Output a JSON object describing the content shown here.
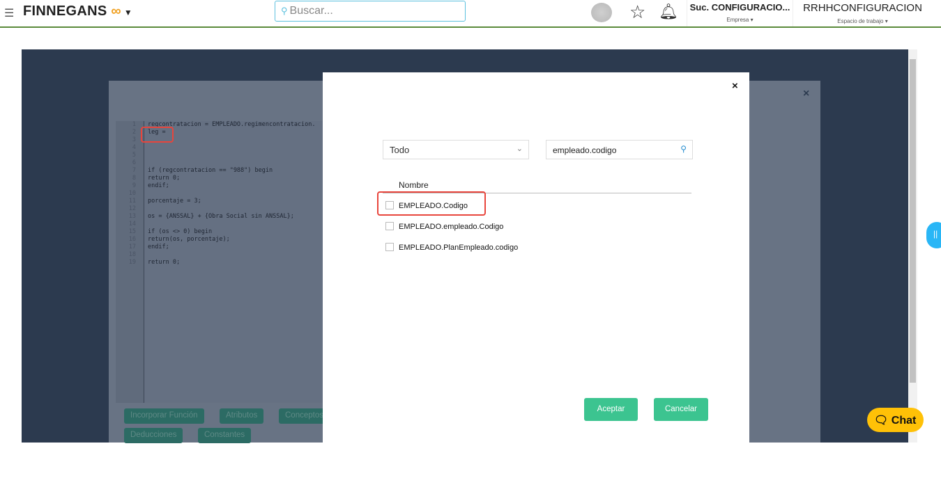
{
  "header": {
    "menu_icon": "hamburger-icon",
    "brand": "FINNEGANS",
    "brand_mark": "CO",
    "search_placeholder": "Buscar...",
    "company": "Suc. CONFIGURACIO...",
    "company_label": "Empresa",
    "workspace": "RRHHCONFIGURACION",
    "workspace_label": "Espacio de trabajo"
  },
  "editor": {
    "line_numbers": [
      "1",
      "2",
      "3",
      "4",
      "5",
      "6",
      "7",
      "8",
      "9",
      "10",
      "11",
      "12",
      "13",
      "14",
      "15",
      "16",
      "17",
      "18",
      "19"
    ],
    "lines": [
      "regcontratacion = EMPLEADO.regimencontratacion.",
      "leg = ",
      "",
      "",
      "",
      "",
      "if (regcontratacion == \"988\") begin",
      "return 0;",
      "endif;",
      "",
      "porcentaje = 3;",
      "",
      "os = {ANSSAL} + {Obra Social sin ANSSAL};",
      "",
      "if (os <> 0) begin",
      "return(os, porcentaje);",
      "endif;",
      "",
      "return 0;"
    ]
  },
  "editor_buttons": [
    "Incorporar Función",
    "Atributos",
    "Conceptos",
    "Deducciones",
    "Constantes"
  ],
  "dialog": {
    "filter": "Todo",
    "search_value": "empleado.codigo",
    "column": "Nombre",
    "rows": [
      "EMPLEADO.Codigo",
      "EMPLEADO.empleado.Codigo",
      "EMPLEADO.PlanEmpleado.codigo"
    ],
    "accept": "Aceptar",
    "cancel": "Cancelar",
    "close": "×"
  },
  "chat": {
    "label": "Chat"
  }
}
